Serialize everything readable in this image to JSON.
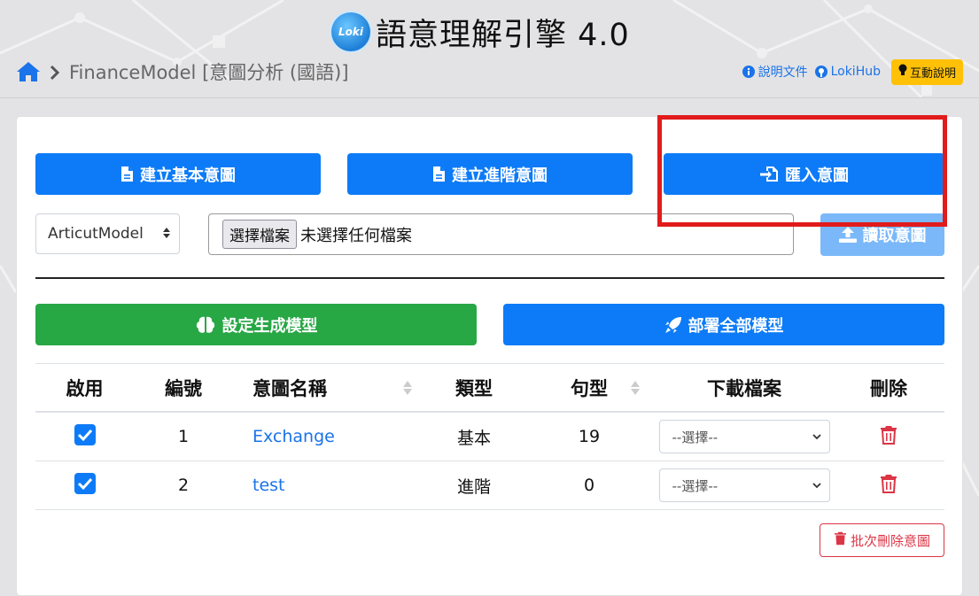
{
  "app": {
    "title": "語意理解引擎 4.0",
    "logo_text": "Loki"
  },
  "breadcrumb": {
    "model": "FinanceModel [意圖分析 (國語)]"
  },
  "top_links": {
    "docs": "說明文件",
    "hub": "LokiHub",
    "help": "互動說明"
  },
  "actions": {
    "create_basic": "建立基本意圖",
    "create_advanced": "建立進階意圖",
    "import": "匯入意圖",
    "load": "讀取意圖",
    "set_model": "設定生成模型",
    "deploy_all": "部署全部模型",
    "batch_delete": "批次刪除意圖"
  },
  "import_form": {
    "model_select": "ArticutModel",
    "file_button": "選擇檔案",
    "file_status": "未選擇任何檔案"
  },
  "table": {
    "headers": {
      "enabled": "啟用",
      "number": "編號",
      "name": "意圖名稱",
      "type": "類型",
      "sentences": "句型",
      "download": "下載檔案",
      "delete": "刪除"
    },
    "rows": [
      {
        "enabled": true,
        "number": "1",
        "name": "Exchange",
        "type": "基本",
        "sentences": "19",
        "download": "--選擇--"
      },
      {
        "enabled": true,
        "number": "2",
        "name": "test",
        "type": "進階",
        "sentences": "0",
        "download": "--選擇--"
      }
    ]
  },
  "colors": {
    "primary": "#0d7bf7",
    "success": "#28a745",
    "danger": "#dc3545",
    "warning": "#ffc107",
    "highlight": "#e11b1b"
  }
}
